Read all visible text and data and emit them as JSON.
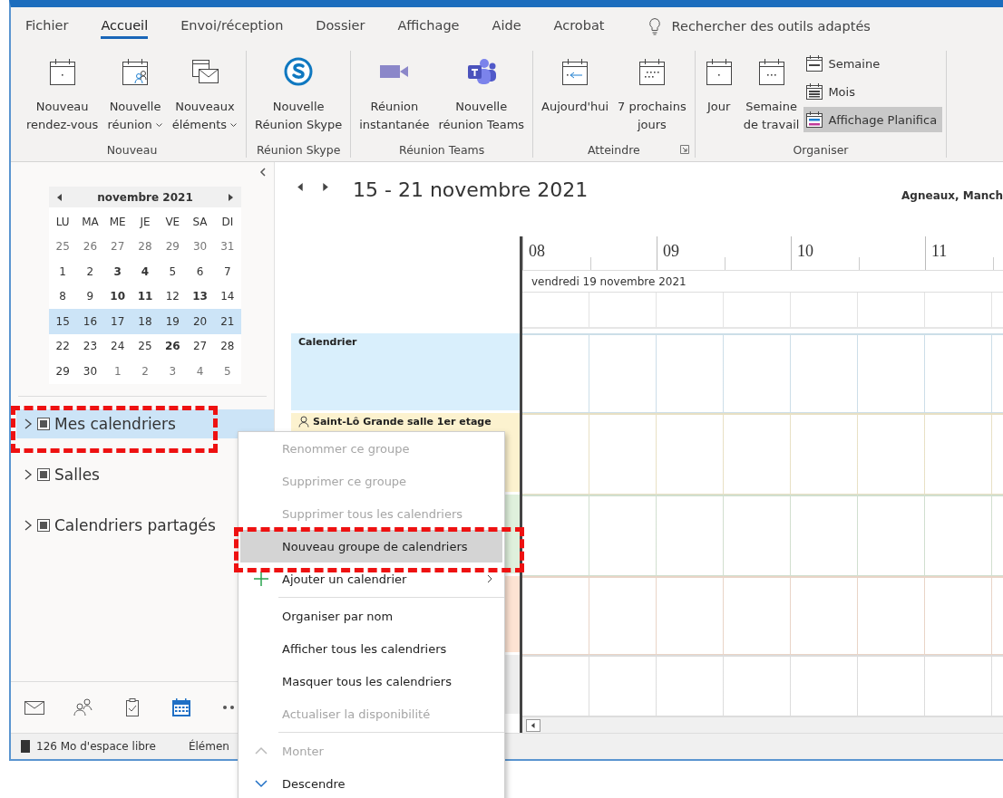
{
  "ribbon_tabs": [
    {
      "label": "Fichier",
      "selected": false
    },
    {
      "label": "Accueil",
      "selected": true
    },
    {
      "label": "Envoi/réception",
      "selected": false
    },
    {
      "label": "Dossier",
      "selected": false
    },
    {
      "label": "Affichage",
      "selected": false
    },
    {
      "label": "Aide",
      "selected": false
    },
    {
      "label": "Acrobat",
      "selected": false
    }
  ],
  "tell_me": {
    "label": "Rechercher des outils adaptés"
  },
  "ribbon_groups": [
    {
      "label": "Nouveau",
      "launcher": false,
      "buttons": [
        {
          "label": "Nouveau\nrendez-vous",
          "dropdown": false
        },
        {
          "label": "Nouvelle\nréunion",
          "dropdown": true
        },
        {
          "label": "Nouveaux\néléments",
          "dropdown": true
        }
      ]
    },
    {
      "label": "Réunion Skype",
      "launcher": false,
      "buttons": [
        {
          "label": "Nouvelle\nRéunion Skype",
          "dropdown": false
        }
      ]
    },
    {
      "label": "Réunion Teams",
      "launcher": false,
      "buttons": [
        {
          "label": "Réunion\ninstantanée",
          "dropdown": false
        },
        {
          "label": "Nouvelle\nréunion Teams",
          "dropdown": false
        }
      ]
    },
    {
      "label": "Atteindre",
      "launcher": true,
      "buttons": [
        {
          "label": "Aujourd'hui",
          "dropdown": false
        },
        {
          "label": "7 prochains\njours",
          "dropdown": false
        }
      ]
    },
    {
      "label": "Organiser",
      "launcher": false,
      "buttons": [
        {
          "label": "Jour",
          "dropdown": false
        },
        {
          "label": "Semaine\nde travail",
          "dropdown": false
        }
      ],
      "small_buttons": [
        {
          "label": "Semaine",
          "selected": false
        },
        {
          "label": "Mois",
          "selected": false
        },
        {
          "label": "Affichage Planifica",
          "selected": true
        }
      ]
    }
  ],
  "mini_calendar": {
    "month": "novembre 2021",
    "weekdays": [
      "LU",
      "MA",
      "ME",
      "JE",
      "VE",
      "SA",
      "DI"
    ],
    "weeks": [
      {
        "selected": false,
        "days": [
          {
            "day": "25",
            "muted": true,
            "bold": false
          },
          {
            "day": "26",
            "muted": true,
            "bold": false
          },
          {
            "day": "27",
            "muted": true,
            "bold": false
          },
          {
            "day": "28",
            "muted": true,
            "bold": false
          },
          {
            "day": "29",
            "muted": true,
            "bold": false
          },
          {
            "day": "30",
            "muted": true,
            "bold": false
          },
          {
            "day": "31",
            "muted": true,
            "bold": false
          }
        ]
      },
      {
        "selected": false,
        "days": [
          {
            "day": "1",
            "muted": false,
            "bold": false
          },
          {
            "day": "2",
            "muted": false,
            "bold": false
          },
          {
            "day": "3",
            "muted": false,
            "bold": true
          },
          {
            "day": "4",
            "muted": false,
            "bold": true
          },
          {
            "day": "5",
            "muted": false,
            "bold": false
          },
          {
            "day": "6",
            "muted": false,
            "bold": false
          },
          {
            "day": "7",
            "muted": false,
            "bold": false
          }
        ]
      },
      {
        "selected": false,
        "days": [
          {
            "day": "8",
            "muted": false,
            "bold": false
          },
          {
            "day": "9",
            "muted": false,
            "bold": false
          },
          {
            "day": "10",
            "muted": false,
            "bold": true
          },
          {
            "day": "11",
            "muted": false,
            "bold": true
          },
          {
            "day": "12",
            "muted": false,
            "bold": false
          },
          {
            "day": "13",
            "muted": false,
            "bold": true
          },
          {
            "day": "14",
            "muted": false,
            "bold": false
          }
        ]
      },
      {
        "selected": true,
        "days": [
          {
            "day": "15",
            "muted": false,
            "bold": false
          },
          {
            "day": "16",
            "muted": false,
            "bold": false
          },
          {
            "day": "17",
            "muted": false,
            "bold": false
          },
          {
            "day": "18",
            "muted": false,
            "bold": false
          },
          {
            "day": "19",
            "muted": false,
            "bold": false
          },
          {
            "day": "20",
            "muted": false,
            "bold": false
          },
          {
            "day": "21",
            "muted": false,
            "bold": false
          }
        ]
      },
      {
        "selected": false,
        "days": [
          {
            "day": "22",
            "muted": false,
            "bold": false
          },
          {
            "day": "23",
            "muted": false,
            "bold": false
          },
          {
            "day": "24",
            "muted": false,
            "bold": false
          },
          {
            "day": "25",
            "muted": false,
            "bold": false
          },
          {
            "day": "26",
            "muted": false,
            "bold": true
          },
          {
            "day": "27",
            "muted": false,
            "bold": false
          },
          {
            "day": "28",
            "muted": false,
            "bold": false
          }
        ]
      },
      {
        "selected": false,
        "days": [
          {
            "day": "29",
            "muted": false,
            "bold": false
          },
          {
            "day": "30",
            "muted": false,
            "bold": false
          },
          {
            "day": "1",
            "muted": true,
            "bold": false
          },
          {
            "day": "2",
            "muted": true,
            "bold": false
          },
          {
            "day": "3",
            "muted": true,
            "bold": false
          },
          {
            "day": "4",
            "muted": true,
            "bold": false
          },
          {
            "day": "5",
            "muted": true,
            "bold": false
          }
        ]
      }
    ]
  },
  "folder_groups": [
    {
      "label": "Mes calendriers",
      "selected": true,
      "annotated": true
    },
    {
      "label": "Salles",
      "selected": false,
      "annotated": false
    },
    {
      "label": "Calendriers partagés",
      "selected": false,
      "annotated": false
    }
  ],
  "nav_bar": [
    {
      "selected": false
    },
    {
      "selected": false
    },
    {
      "selected": false
    },
    {
      "selected": true
    },
    {
      "selected": false
    }
  ],
  "status_bar": [
    "126 Mo d'espace libre",
    "Élémen"
  ],
  "schedule": {
    "range": "15 - 21 novembre 2021",
    "location": "Agneaux, Manch",
    "hours": [
      "08",
      "09",
      "10",
      "11"
    ],
    "date": "vendredi 19 novembre 2021",
    "rows": [
      {
        "kind": "calendar",
        "label": "Calendrier",
        "color": "#d9effc"
      },
      {
        "kind": "room",
        "label": "Saint-Lô Grande salle 1er etage",
        "color": "#fcf2cf"
      },
      {
        "kind": "covered",
        "color": "#dff0dc"
      },
      {
        "kind": "covered",
        "color": "#fde3d3"
      },
      {
        "kind": "covered",
        "color": "#ededed"
      }
    ]
  },
  "context_menu": [
    {
      "kind": "action",
      "label": "Renommer ce groupe",
      "disabled": true,
      "selected": false,
      "annotated": false
    },
    {
      "kind": "action",
      "label": "Supprimer ce groupe",
      "disabled": true,
      "selected": false,
      "annotated": false
    },
    {
      "kind": "action",
      "label": "Supprimer tous les calendriers",
      "disabled": true,
      "selected": false,
      "annotated": false
    },
    {
      "kind": "action",
      "label": "Nouveau groupe de calendriers",
      "disabled": false,
      "selected": true,
      "annotated": true
    },
    {
      "kind": "add",
      "label": "Ajouter un calendrier",
      "disabled": false,
      "selected": false,
      "annotated": false
    },
    {
      "kind": "separator"
    },
    {
      "kind": "action",
      "label": "Organiser par nom",
      "disabled": false,
      "selected": false,
      "annotated": false
    },
    {
      "kind": "action",
      "label": "Afficher tous les calendriers",
      "disabled": false,
      "selected": false,
      "annotated": false
    },
    {
      "kind": "action",
      "label": "Masquer tous les calendriers",
      "disabled": false,
      "selected": false,
      "annotated": false
    },
    {
      "kind": "action",
      "label": "Actualiser la disponibilité",
      "disabled": true,
      "selected": false,
      "annotated": false
    },
    {
      "kind": "separator"
    },
    {
      "kind": "move-up",
      "label": "Monter",
      "disabled": true,
      "selected": false,
      "annotated": false
    },
    {
      "kind": "move-down",
      "label": "Descendre",
      "disabled": false,
      "selected": false,
      "annotated": false
    }
  ]
}
